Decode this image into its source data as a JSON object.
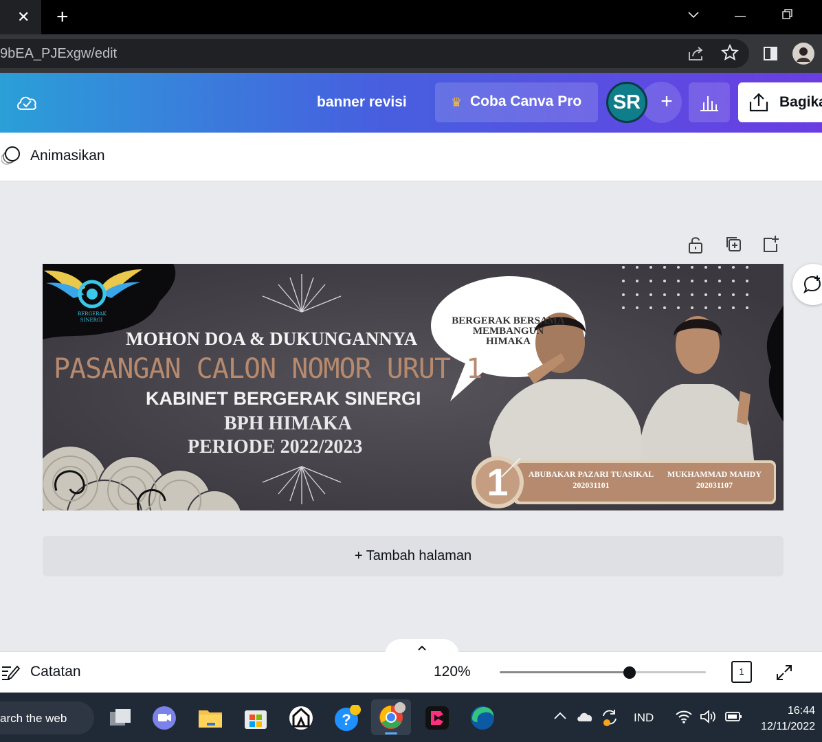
{
  "browser": {
    "tab_close": "✕",
    "new_tab": "+",
    "url": "9bEA_PJExgw/edit"
  },
  "header": {
    "doc_title": "banner revisi",
    "pro_button": "Coba Canva Pro",
    "avatar_initials": "SR",
    "add": "+",
    "share_button": "Bagikan"
  },
  "toolbar": {
    "animate": "Animasikan"
  },
  "banner": {
    "logo_line1": "BERGERAK",
    "logo_line2": "SINERGI",
    "headline": "MOHON DOA & DUKUNGANNYA",
    "candidate_line": "PASANGAN CALON NOMOR URUT 1",
    "cabinet": "KABINET BERGERAK SINERGI",
    "org": "BPH HIMAKA",
    "period": "PERIODE 2022/2023",
    "bubble_line1": "BERGERAK BERSAMA",
    "bubble_line2": "MEMBANGUN",
    "bubble_line3": "HIMAKA",
    "number": "1",
    "candidate1_name": "ABUBAKAR PAZARI TUASIKAL",
    "candidate1_id": "202031101",
    "candidate2_name": "MUKHAMMAD MAHDY",
    "candidate2_id": "202031107"
  },
  "canvas": {
    "add_page": "+ Tambah halaman"
  },
  "bottombar": {
    "notes": "Catatan",
    "zoom": "120%",
    "zoom_fraction": 0.63,
    "page_count": "1"
  },
  "taskbar": {
    "search_text": "arch the web",
    "language": "IND",
    "time": "16:44",
    "date": "12/11/2022"
  },
  "colors": {
    "header_start": "#2b9fd8",
    "header_end": "#6a3de3",
    "banner_bg": "#3b3840",
    "accent_brown": "#b58a6e"
  }
}
